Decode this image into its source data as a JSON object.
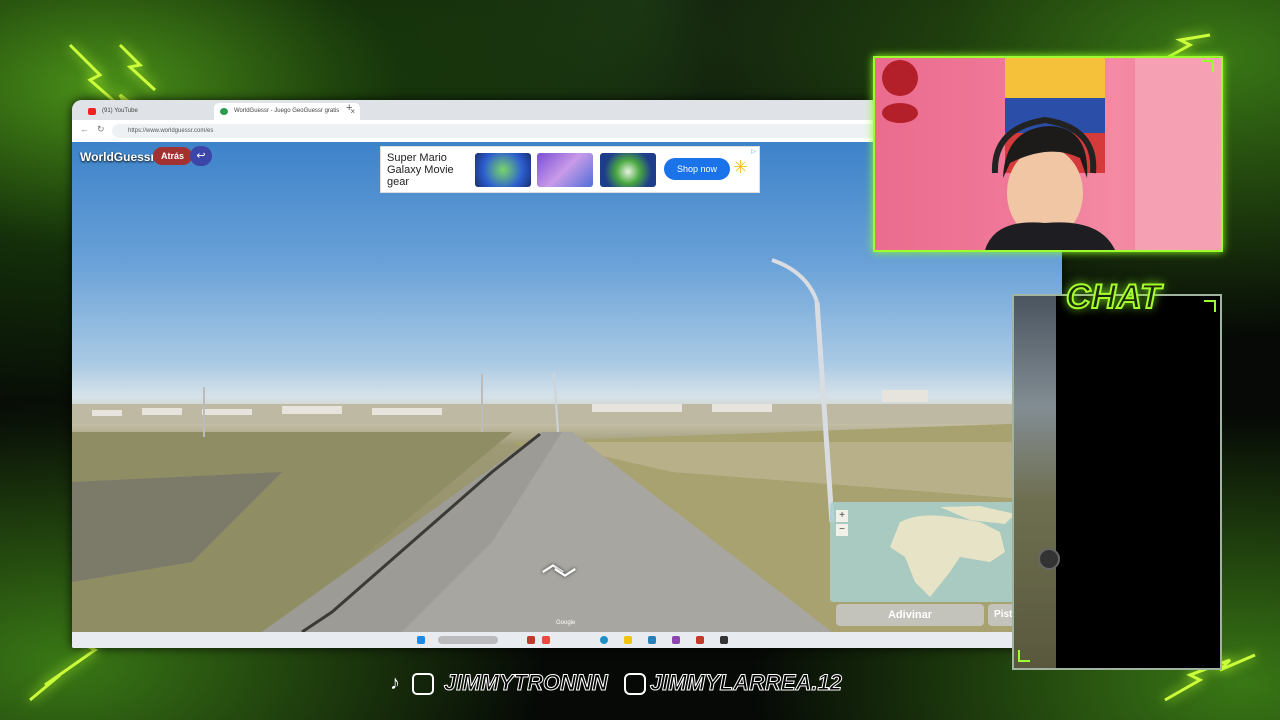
{
  "browser": {
    "tabs": [
      {
        "label": "(91) YouTube"
      },
      {
        "label": "WorldGuessr - Juego GeoGuessr gratis"
      }
    ],
    "url": "https://www.worldguessr.com/es"
  },
  "game": {
    "logo": "WorldGuessr",
    "back_label": "Atrás",
    "return_icon": "↩",
    "guess_label": "Adivinar",
    "hint_label": "Pista",
    "map_zoom_in": "+",
    "map_zoom_out": "−",
    "google_mark": "Google"
  },
  "ad": {
    "title": "Super Mario Galaxy Movie gear",
    "button": "Shop now"
  },
  "chat": {
    "title": "CHAT"
  },
  "socials": {
    "tiktok_youtube_handle": "JIMMYTRONNN",
    "instagram_handle": "JIMMYLARREA.12"
  },
  "colors": {
    "neon": "#a6ff2a",
    "back_btn": "#a23232",
    "return_btn": "#3c46a8",
    "ad_btn": "#1a73e8"
  }
}
